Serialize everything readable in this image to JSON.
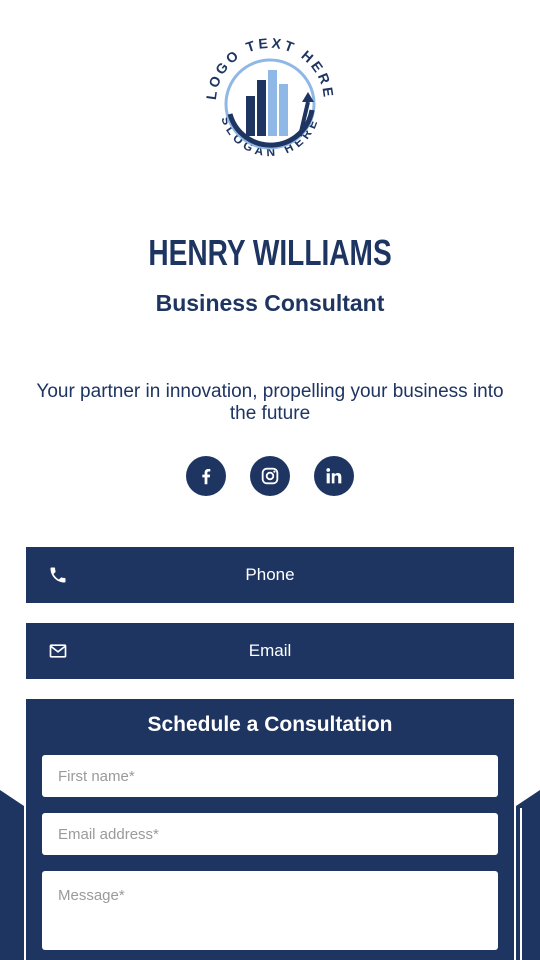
{
  "logo": {
    "top_text": "LOGO TEXT HERE",
    "bottom_text": "SLOGAN HERE"
  },
  "profile": {
    "name": "HENRY WILLIAMS",
    "title": "Business Consultant",
    "tagline": "Your partner in innovation, propelling your business into the future"
  },
  "socials": [
    {
      "name": "facebook",
      "icon": "facebook-icon"
    },
    {
      "name": "instagram",
      "icon": "instagram-icon"
    },
    {
      "name": "linkedin",
      "icon": "linkedin-icon"
    }
  ],
  "contact": {
    "phone_label": "Phone",
    "phone_icon": "phone-icon",
    "email_label": "Email",
    "email_icon": "mail-icon"
  },
  "form": {
    "title": "Schedule a Consultation",
    "first_name_placeholder": "First name*",
    "email_placeholder": "Email address*",
    "message_placeholder": "Message*"
  },
  "colors": {
    "primary": "#1e3461",
    "accent_light": "#8fb8e6",
    "background": "#ffffff"
  }
}
